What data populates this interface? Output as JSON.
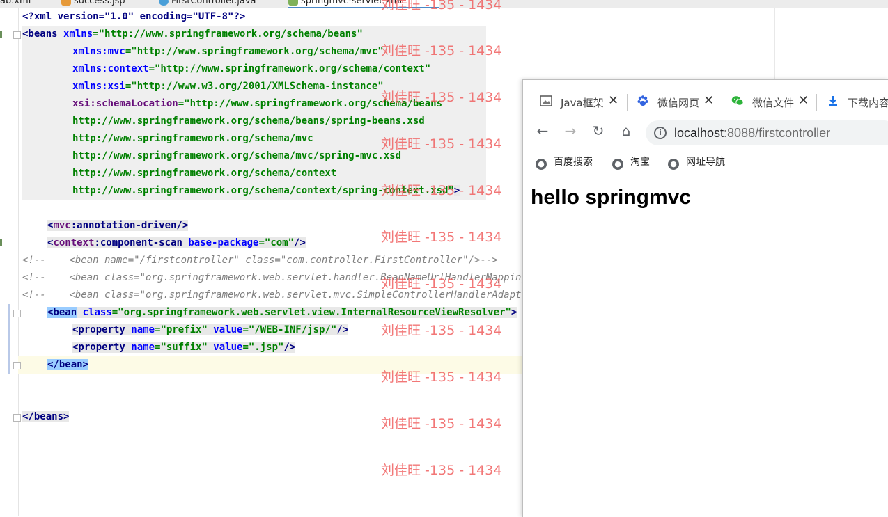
{
  "editor": {
    "tabs": [
      {
        "label": "ab.xml"
      },
      {
        "label": "success.jsp"
      },
      {
        "label": "FirstController.java"
      },
      {
        "label": "springmvc-servlet.xml"
      }
    ],
    "lines": {
      "l1": "<?xml version=\"1.0\" encoding=\"UTF-8\"?>",
      "l2_tag": "<beans",
      "l2_attr": " xmlns",
      "l2_val": "=\"http://www.springframework.org/schema/beans\"",
      "l3_ns": "xmlns:mvc",
      "l3_val": "=\"http://www.springframework.org/schema/mvc\"",
      "l4_ns": "xmlns:context",
      "l4_val": "=\"http://www.springframework.org/schema/context\"",
      "l5_ns": "xmlns:xsi",
      "l5_val": "=\"http://www.w3.org/2001/XMLSchema-instance\"",
      "l6_ns": "xsi:schemaLocation",
      "l6_val": "=\"http://www.springframework.org/schema/beans",
      "l7": "http://www.springframework.org/schema/beans/spring-beans.xsd",
      "l8": "http://www.springframework.org/schema/mvc",
      "l9": "http://www.springframework.org/schema/mvc/spring-mvc.xsd",
      "l10": "http://www.springframework.org/schema/context",
      "l11": "http://www.springframework.org/schema/context/spring-context.xsd\"",
      "l11_end": ">",
      "l13_open": "<",
      "l13_ns": "mvc",
      "l13_rest": ":annotation-driven",
      "l13_close": "/>",
      "l14_open": "<",
      "l14_ns": "context",
      "l14_rest": ":component-scan",
      "l14_attr": " base-package",
      "l14_val": "=\"com\"",
      "l14_close": "/>",
      "l15": "<!--    <bean name=\"/firstcontroller\" class=\"com.controller.FirstController\"/>-->",
      "l16": "<!--    <bean class=\"org.springframework.web.servlet.handler.BeanNameUrlHandlerMapping\"/>-->",
      "l17": "<!--    <bean class=\"org.springframework.web.servlet.mvc.SimpleControllerHandlerAdapter\"/>-->",
      "l18_tag": "<bean",
      "l18_attr": " class",
      "l18_val": "=\"org.springframework.web.servlet.view.InternalResourceViewResolver\"",
      "l18_end": ">",
      "l19_tag": "<property",
      "l19_a1": " name",
      "l19_v1": "=\"prefix\"",
      "l19_a2": " value",
      "l19_v2": "=\"/WEB-INF/jsp/\"",
      "l19_end": "/>",
      "l20_tag": "<property",
      "l20_a1": " name",
      "l20_v1": "=\"suffix\"",
      "l20_a2": " value",
      "l20_v2": "=\".jsp\"",
      "l20_end": "/>",
      "l21": "</bean>",
      "l24": "</beans>"
    },
    "watermark": "刘佳旺 -135 - 1434"
  },
  "browser": {
    "tabs": [
      {
        "label": "Java框架",
        "icon": "image-icon"
      },
      {
        "label": "微信网页",
        "icon": "baidu-paw-icon"
      },
      {
        "label": "微信文件",
        "icon": "wechat-icon"
      },
      {
        "label": "下载内容",
        "icon": "download-icon"
      }
    ],
    "tab_close": "✕",
    "nav": {
      "back": "←",
      "forward": "→",
      "reload": "↻",
      "home": "⌂",
      "info": "i"
    },
    "address": {
      "host": "localhost",
      "rest": ":8088/firstcontroller"
    },
    "bookmarks": [
      {
        "label": "百度搜索"
      },
      {
        "label": "淘宝"
      },
      {
        "label": "网址导航"
      }
    ],
    "page_heading": "hello springmvc"
  },
  "colors": {
    "tag": "#000080",
    "attr": "#0000ff",
    "value": "#008000",
    "namespace": "#660e7a",
    "comment": "#808080",
    "watermark": "#f06060"
  }
}
